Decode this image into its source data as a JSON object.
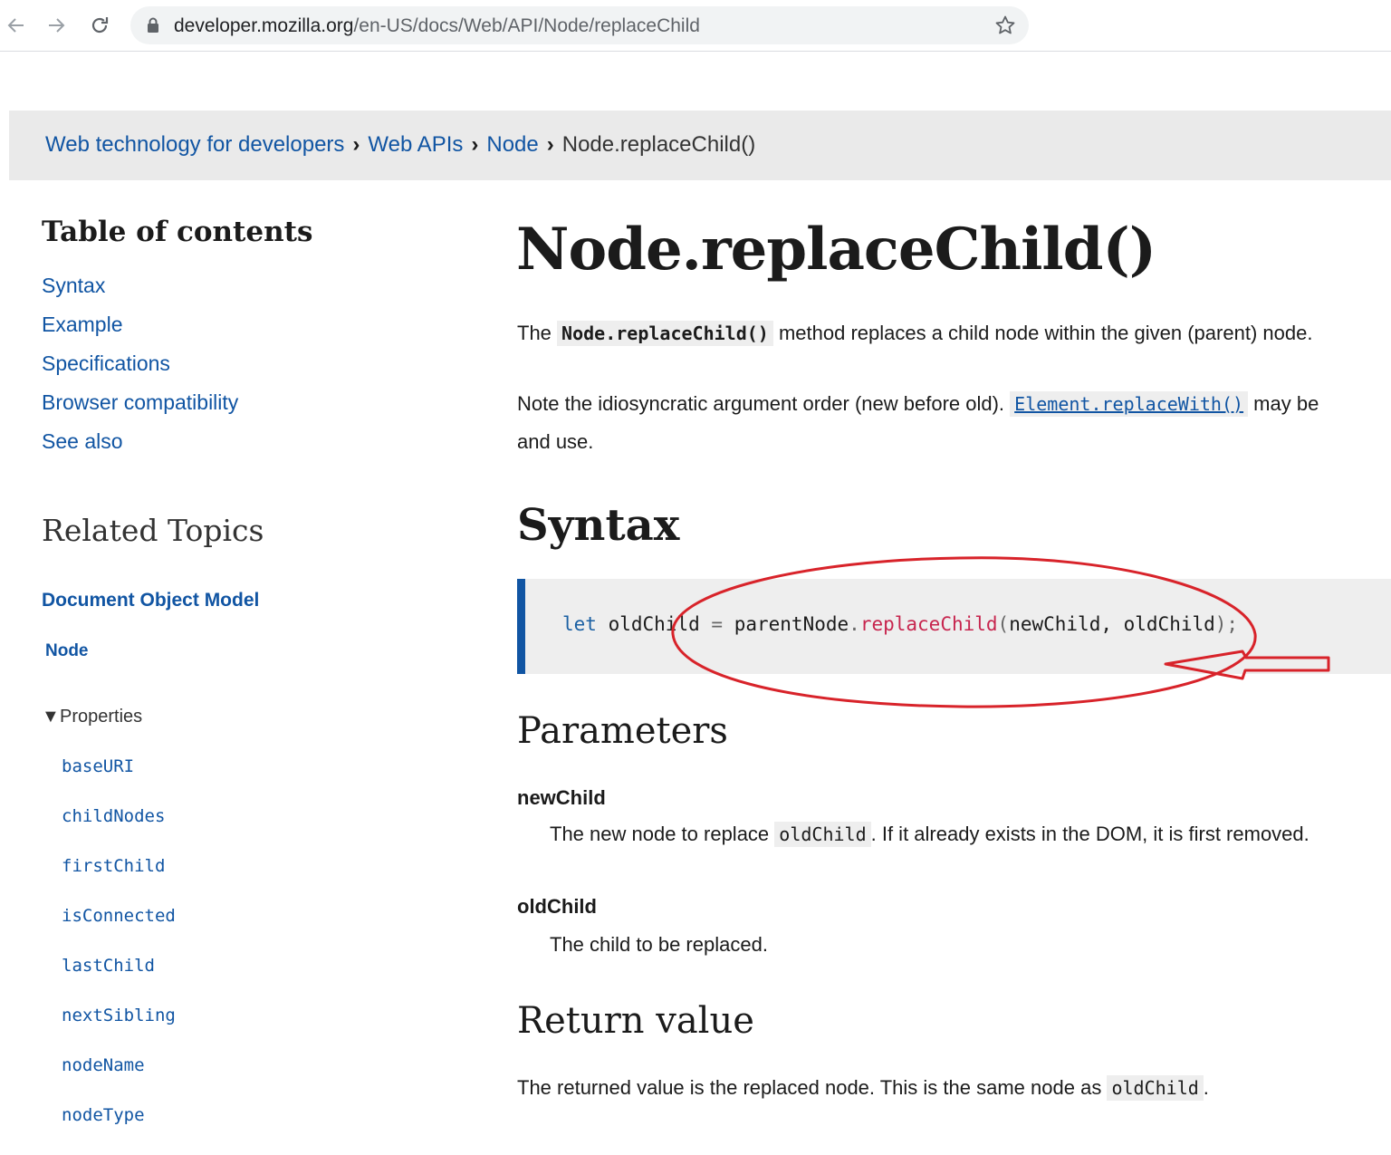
{
  "browser": {
    "url_host": "developer.mozilla.org",
    "url_path": "/en-US/docs/Web/API/Node/replaceChild"
  },
  "breadcrumb": {
    "items": [
      "Web technology for developers",
      "Web APIs",
      "Node"
    ],
    "current": "Node.replaceChild()"
  },
  "sidebar": {
    "toc_title": "Table of contents",
    "toc": [
      "Syntax",
      "Example",
      "Specifications",
      "Browser compatibility",
      "See also"
    ],
    "related_title": "Related Topics",
    "dom_link": "Document Object Model",
    "node_link": "Node",
    "properties_label": "Properties",
    "properties": [
      "baseURI",
      "childNodes",
      "firstChild",
      "isConnected",
      "lastChild",
      "nextSibling",
      "nodeName",
      "nodeType"
    ]
  },
  "main": {
    "title": "Node.replaceChild()",
    "intro_pre": "The",
    "intro_code": "Node.replaceChild()",
    "intro_post": "method replaces a child node within the given (parent) node.",
    "note_pre": "Note the idiosyncratic argument order (new before old).",
    "note_link": "Element.replaceWith()",
    "note_post": "may be",
    "note_line2": "and use.",
    "syntax_heading": "Syntax",
    "code": {
      "kw": "let",
      "var": "oldChild",
      "op": "=",
      "obj": "parentNode",
      "dot": ".",
      "method": "replaceChild",
      "open": "(",
      "args": "newChild, oldChild",
      "close": ")",
      "semi": ";"
    },
    "params_heading": "Parameters",
    "param1_name": "newChild",
    "param1_desc_pre": "The new node to replace",
    "param1_code": "oldChild",
    "param1_desc_post": ". If it already exists in the DOM, it is first removed.",
    "param2_name": "oldChild",
    "param2_desc": "The child to be replaced.",
    "return_heading": "Return value",
    "return_pre": "The returned value is the replaced node. This is the same node as",
    "return_code": "oldChild",
    "return_post": "."
  },
  "colors": {
    "link": "#1155a3",
    "annotation": "#d8232a",
    "code_bg": "#eeeeee"
  },
  "icons": {
    "back": "arrow-left-icon",
    "forward": "arrow-right-icon",
    "reload": "reload-icon",
    "lock": "lock-icon",
    "bookmark": "star-icon"
  }
}
